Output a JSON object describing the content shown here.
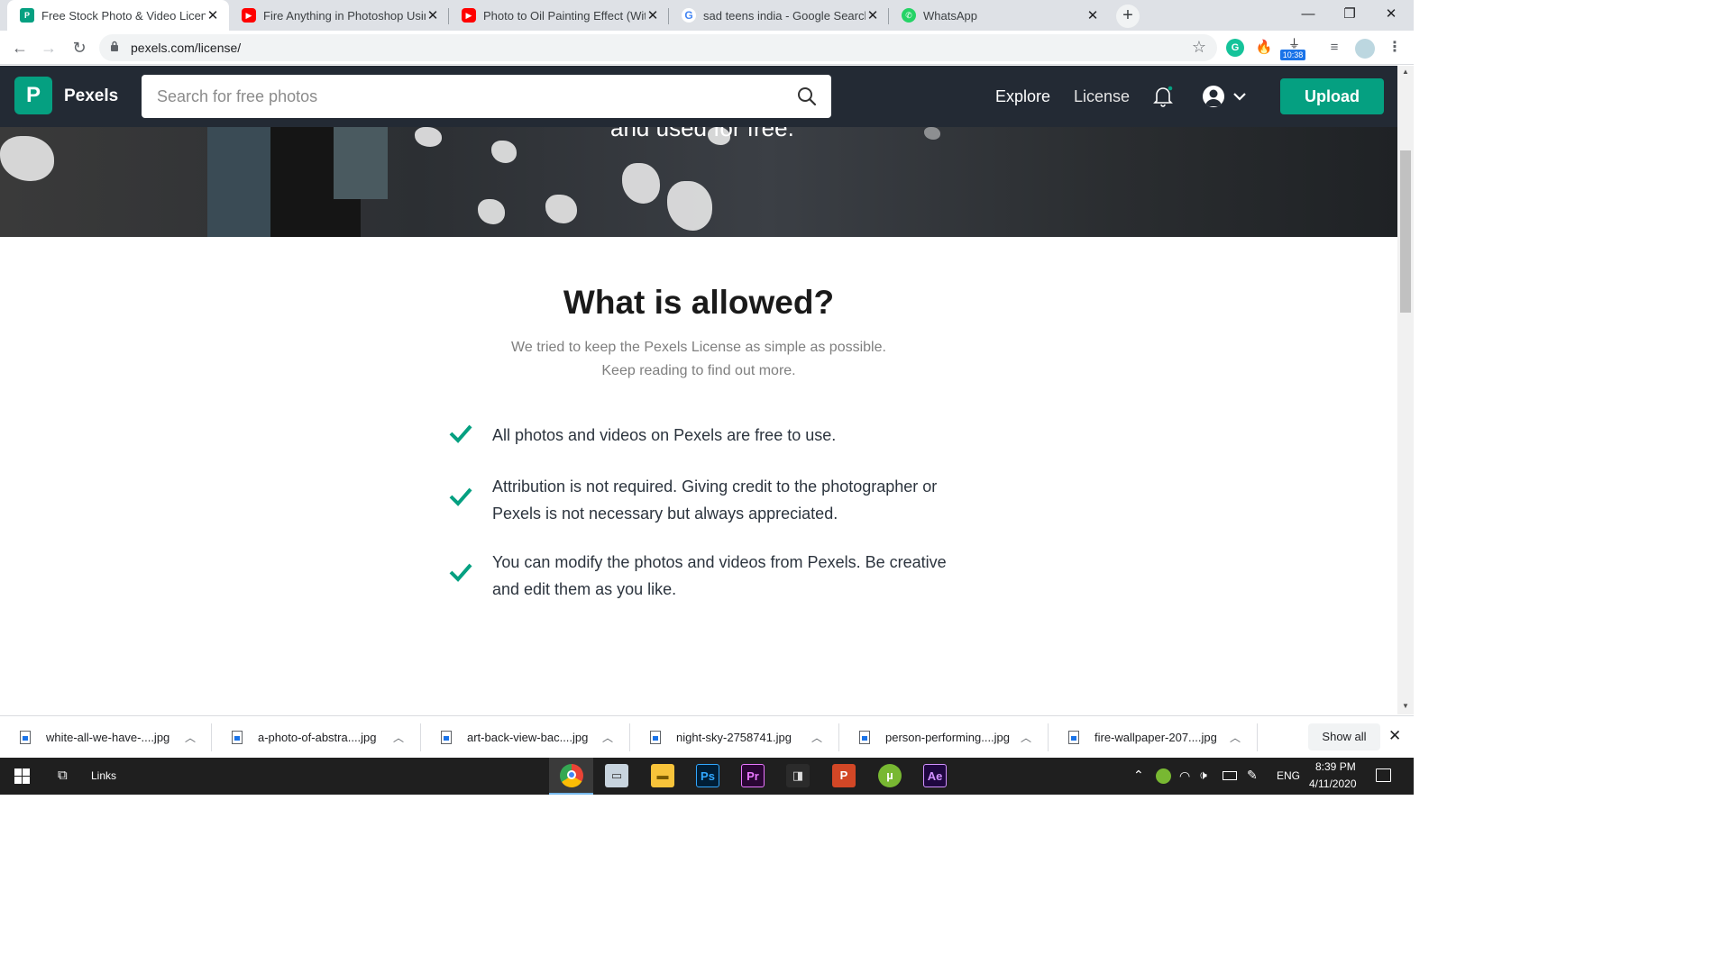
{
  "browser": {
    "tabs": [
      {
        "title": "Free Stock Photo & Video License",
        "favicon": "pexels-favicon",
        "active": true
      },
      {
        "title": "Fire Anything in Photoshop Using",
        "favicon": "youtube-favicon",
        "active": false
      },
      {
        "title": "Photo to Oil Painting Effect (With",
        "favicon": "youtube-favicon",
        "active": false
      },
      {
        "title": "sad teens india - Google Search",
        "favicon": "google-favicon",
        "active": false
      },
      {
        "title": "WhatsApp",
        "favicon": "whatsapp-favicon",
        "active": false
      }
    ],
    "url": "pexels.com/license/",
    "extension_badge": "10:38"
  },
  "pexels_header": {
    "brand": "Pexels",
    "search_placeholder": "Search for free photos",
    "nav": {
      "explore": "Explore",
      "license": "License"
    },
    "upload_label": "Upload"
  },
  "hero": {
    "text": "and used for free."
  },
  "allowed_section": {
    "title": "What is allowed?",
    "subtitle_line1": "We tried to keep the Pexels License as simple as possible.",
    "subtitle_line2": "Keep reading to find out more.",
    "items": [
      {
        "line1": "All photos and videos on Pexels are free to use.",
        "line2": ""
      },
      {
        "line1": "Attribution is not required. Giving credit to the photographer or",
        "line2": "Pexels is not necessary but always appreciated."
      },
      {
        "line1": "You can modify the photos and videos from Pexels. Be creative",
        "line2": "and edit them as you like."
      }
    ]
  },
  "downloads": {
    "files": [
      "white-all-we-have-....jpg",
      "a-photo-of-abstra....jpg",
      "art-back-view-bac....jpg",
      "night-sky-2758741.jpg",
      "person-performing....jpg",
      "fire-wallpaper-207....jpg"
    ],
    "show_all": "Show all"
  },
  "taskbar": {
    "links_label": "Links",
    "language": "ENG",
    "time": "8:39 PM",
    "date": "4/11/2020",
    "apps": [
      "chrome-icon",
      "explorer-app-icon",
      "file-explorer-icon",
      "photoshop-icon",
      "premiere-icon",
      "media-encoder-icon",
      "powerpoint-icon",
      "utorrent-icon",
      "after-effects-icon"
    ]
  },
  "colors": {
    "brand_green": "#05a081",
    "header_bg": "#232a34"
  }
}
